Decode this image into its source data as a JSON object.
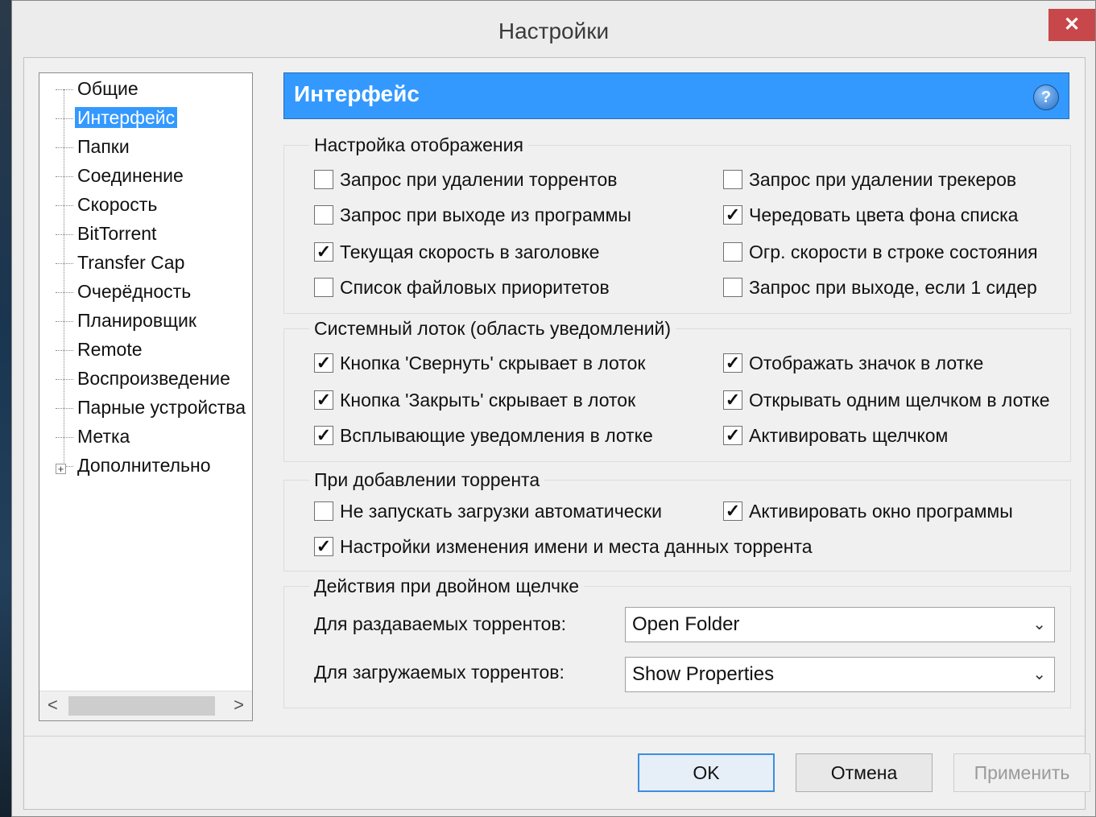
{
  "window": {
    "title": "Настройки",
    "close_symbol": "✕"
  },
  "tree": {
    "items": [
      {
        "label": "Общие"
      },
      {
        "label": "Интерфейс",
        "selected": true
      },
      {
        "label": "Папки"
      },
      {
        "label": "Соединение"
      },
      {
        "label": "Скорость"
      },
      {
        "label": "BitTorrent"
      },
      {
        "label": "Transfer Cap"
      },
      {
        "label": "Очерёдность"
      },
      {
        "label": "Планировщик"
      },
      {
        "label": "Remote"
      },
      {
        "label": "Воспроизведение"
      },
      {
        "label": "Парные устройства"
      },
      {
        "label": "Метка"
      },
      {
        "label": "Дополнительно",
        "expandable": true
      }
    ],
    "scroll_left": "<",
    "scroll_right": ">"
  },
  "header": {
    "title": "Интерфейс",
    "help": "?"
  },
  "display": {
    "title": "Настройка отображения",
    "options": [
      {
        "label": "Запрос при удалении торрентов",
        "checked": false
      },
      {
        "label": "Запрос при удалении трекеров",
        "checked": false
      },
      {
        "label": "Запрос при выходе из программы",
        "checked": false
      },
      {
        "label": "Чередовать цвета фона списка",
        "checked": true
      },
      {
        "label": "Текущая скорость в заголовке",
        "checked": true
      },
      {
        "label": "Огр. скорости в строке состояния",
        "checked": false
      },
      {
        "label": "Список файловых приоритетов",
        "checked": false
      },
      {
        "label": "Запрос при выходе, если 1 сидер",
        "checked": false
      }
    ]
  },
  "tray": {
    "title": "Системный лоток (область уведомлений)",
    "options": [
      {
        "label": "Кнопка 'Свернуть' скрывает в лоток",
        "checked": true
      },
      {
        "label": "Отображать значок в лотке",
        "checked": true
      },
      {
        "label": "Кнопка 'Закрыть' скрывает в лоток",
        "checked": true
      },
      {
        "label": "Открывать одним щелчком в лотке",
        "checked": true
      },
      {
        "label": "Всплывающие уведомления в лотке",
        "checked": true
      },
      {
        "label": "Активировать щелчком",
        "checked": true
      }
    ]
  },
  "adding": {
    "title": "При добавлении торрента",
    "options": [
      {
        "label": "Не запускать загрузки автоматически",
        "checked": false
      },
      {
        "label": "Активировать окно программы",
        "checked": true
      },
      {
        "label": "Настройки изменения имени и места данных торрента",
        "checked": true
      }
    ]
  },
  "dblclick": {
    "title": "Действия при двойном щелчке",
    "seeding_label": "Для раздаваемых торрентов:",
    "seeding_value": "Open Folder",
    "downloading_label": "Для загружаемых торрентов:",
    "downloading_value": "Show Properties"
  },
  "buttons": {
    "ok": "OK",
    "cancel": "Отмена",
    "apply": "Применить"
  },
  "colors": {
    "accent": "#3399ff",
    "close": "#c7474a"
  }
}
